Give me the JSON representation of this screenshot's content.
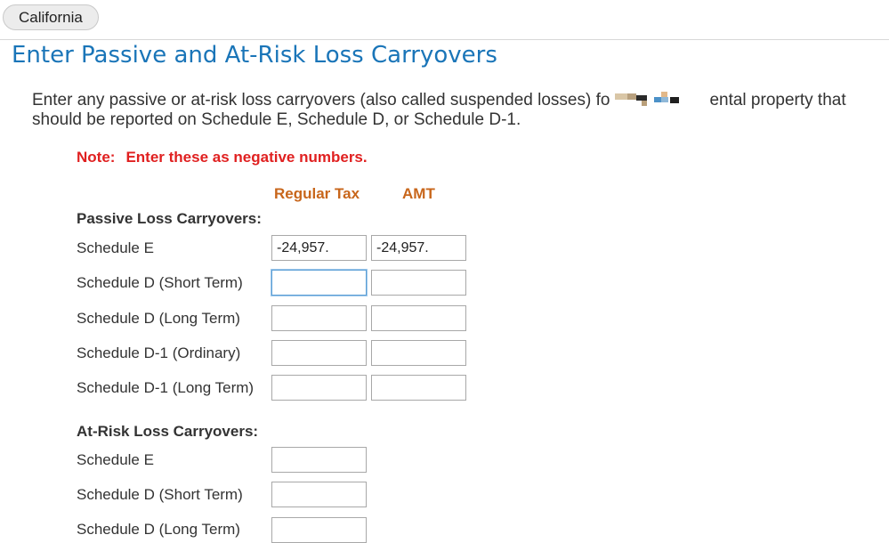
{
  "header": {
    "state_tab": "California",
    "title": "Enter Passive and At-Risk Loss Carryovers"
  },
  "intro": {
    "line1_start": "Enter any passive or at-risk loss carryovers (also called suspended losses) fo",
    "line1_end": "ental property that",
    "line2": "should be reported on Schedule E, Schedule D, or Schedule D-1."
  },
  "note": {
    "label": "Note:",
    "text": "Enter these as negative numbers."
  },
  "columns": {
    "regular": "Regular Tax",
    "amt": "AMT"
  },
  "passive": {
    "heading": "Passive Loss Carryovers:",
    "rows": [
      {
        "label": "Schedule E",
        "regular": "-24,957.",
        "amt": "-24,957."
      },
      {
        "label": "Schedule D (Short Term)",
        "regular": "",
        "amt": ""
      },
      {
        "label": "Schedule D (Long Term)",
        "regular": "",
        "amt": ""
      },
      {
        "label": "Schedule D-1 (Ordinary)",
        "regular": "",
        "amt": ""
      },
      {
        "label": "Schedule D-1 (Long Term)",
        "regular": "",
        "amt": ""
      }
    ]
  },
  "at_risk": {
    "heading": "At-Risk Loss Carryovers:",
    "rows": [
      {
        "label": "Schedule E",
        "regular": ""
      },
      {
        "label": "Schedule D (Short Term)",
        "regular": ""
      },
      {
        "label": "Schedule D (Long Term)",
        "regular": ""
      }
    ]
  },
  "colors": {
    "title": "#1a75b8",
    "note": "#e02020",
    "column_heading": "#c8661b",
    "focus_border": "#5b9fd6"
  }
}
